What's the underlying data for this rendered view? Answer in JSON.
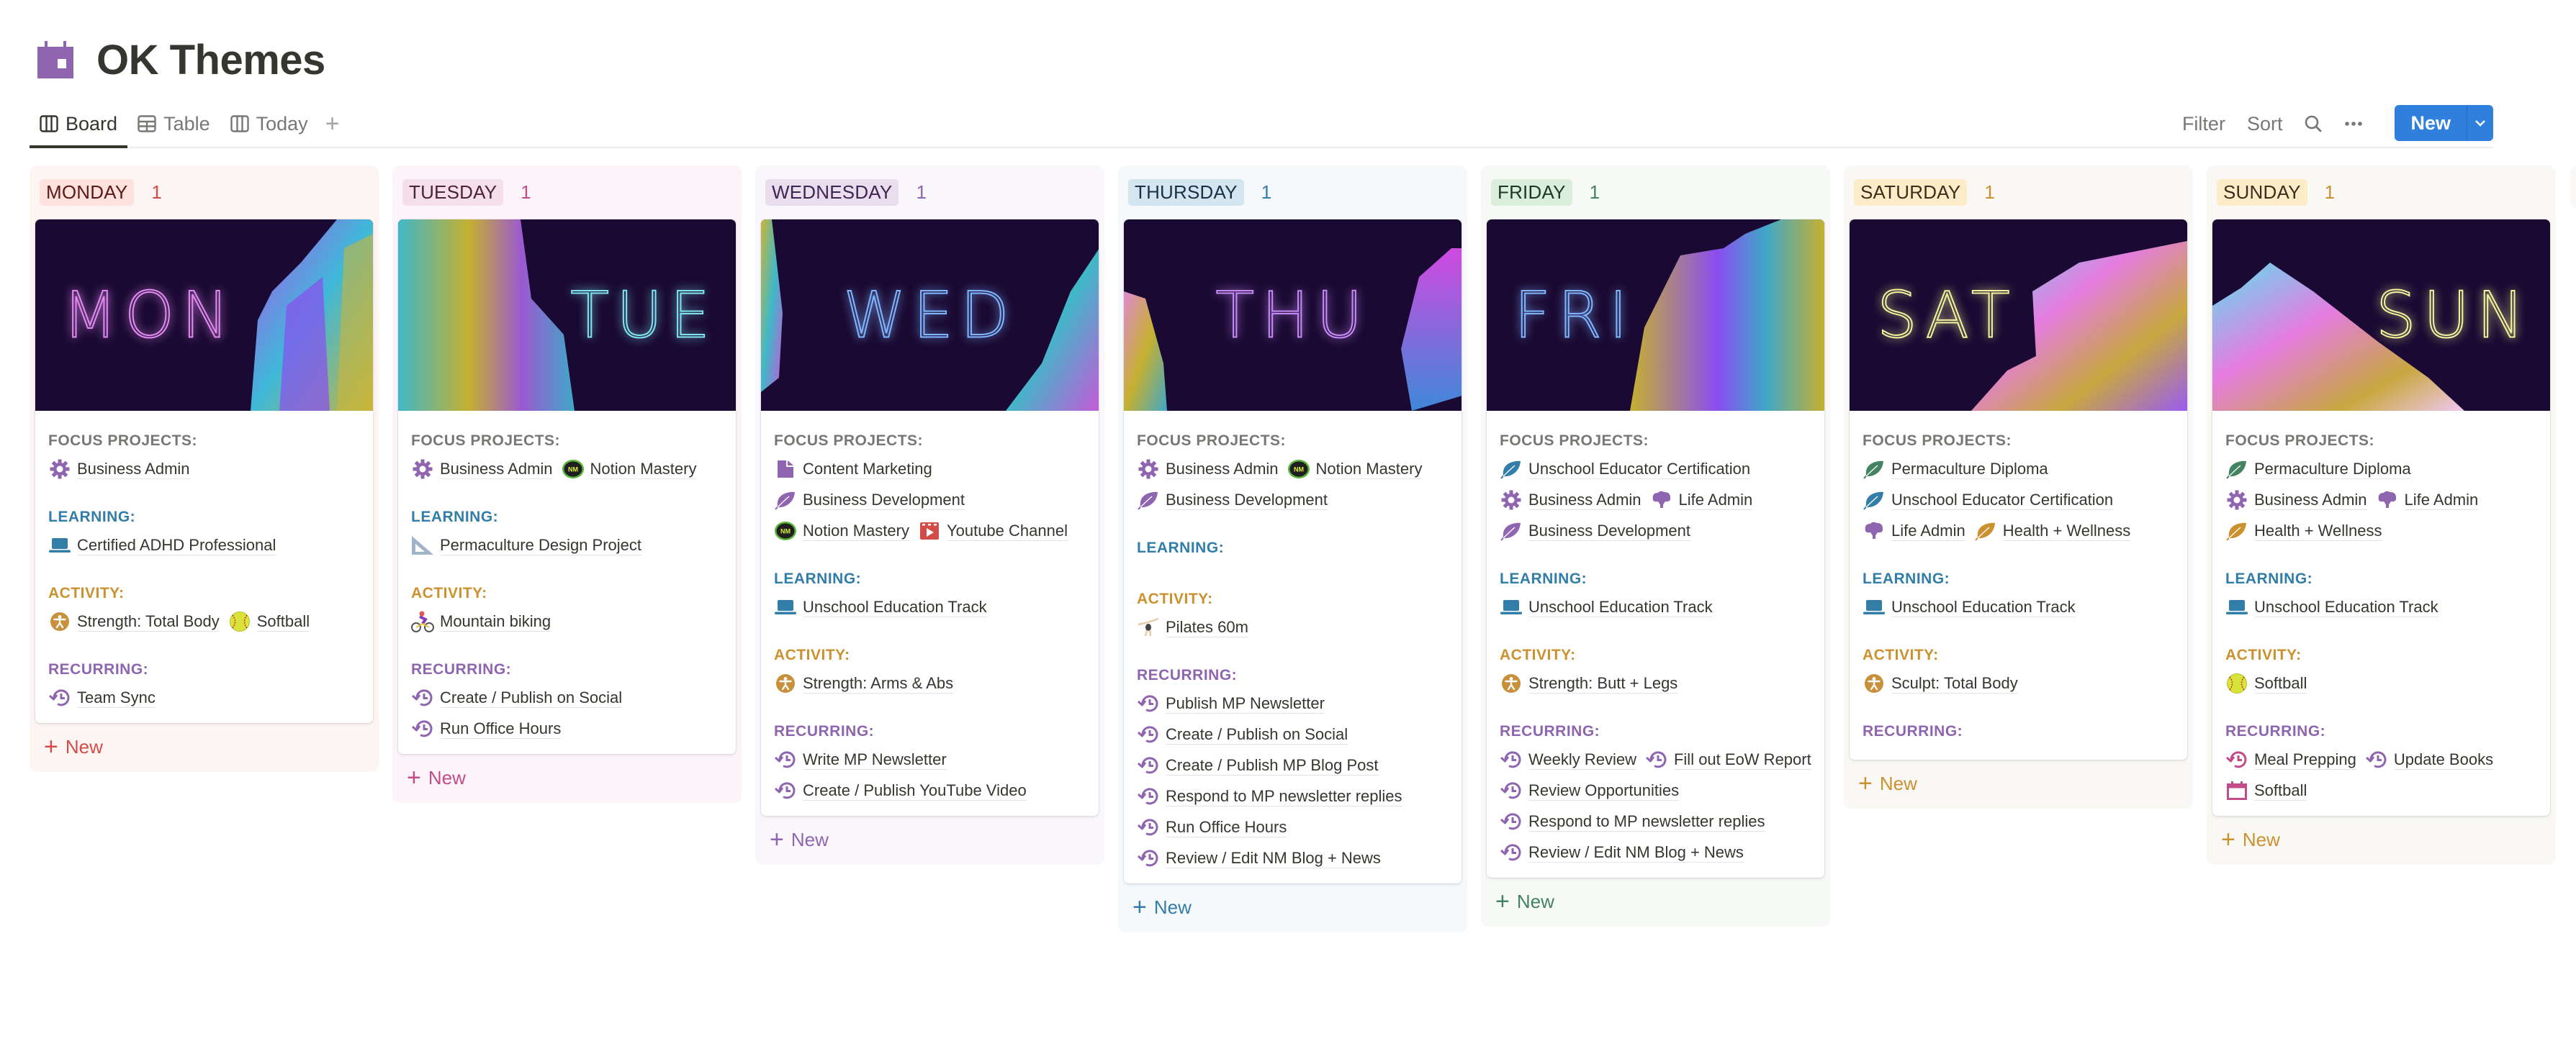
{
  "page": {
    "title": "OK Themes",
    "title_icon": "calendar-icon",
    "title_icon_color": "#9065b0"
  },
  "views": {
    "tabs": [
      {
        "label": "Board",
        "icon": "board-icon",
        "active": true
      },
      {
        "label": "Table",
        "icon": "table-icon",
        "active": false
      },
      {
        "label": "Today",
        "icon": "board-icon",
        "active": false
      }
    ],
    "add_view_icon": "plus-icon"
  },
  "toolbar": {
    "filter_label": "Filter",
    "sort_label": "Sort",
    "search_icon": "search-icon",
    "more_icon": "more-icon",
    "new_label": "New",
    "new_caret_icon": "chevron-down-icon",
    "new_color": "#2f80dd"
  },
  "section_labels": {
    "focus": "FOCUS PROJECTS:",
    "learning": "LEARNING:",
    "activity": "ACTIVITY:",
    "recurring": "RECURRING:"
  },
  "section_colors": {
    "focus": "#787774",
    "learning": "#337ea9",
    "activity": "#cb912f",
    "recurring": "#9065b0"
  },
  "add_new_label": "New",
  "columns": [
    {
      "day": "MONDAY",
      "count": "1",
      "cover_text": "MON",
      "colors": {
        "bg": "#fdf5f4",
        "pill": "#ffe2dd",
        "pill_text": "#5d1715",
        "count": "#d44c47",
        "neon": "#e38af0"
      },
      "focus": [
        {
          "icon": "gear-icon",
          "label": "Business Admin"
        }
      ],
      "learning": [
        {
          "icon": "laptop-icon",
          "label": "Certified ADHD Professional"
        }
      ],
      "activity": [
        {
          "icon": "accessibility-icon",
          "label": "Strength: Total Body"
        },
        {
          "icon": "softball-icon",
          "label": "Softball"
        }
      ],
      "recurring": [
        {
          "icon": "history-icon",
          "label": "Team Sync"
        }
      ]
    },
    {
      "day": "TUESDAY",
      "count": "1",
      "cover_text": "TUE",
      "colors": {
        "bg": "#fcf4f8",
        "pill": "#f5e0e9",
        "pill_text": "#4c2337",
        "count": "#c14c8a",
        "neon": "#7fe3ee"
      },
      "focus": [
        {
          "icon": "gear-icon",
          "label": "Business Admin"
        },
        {
          "icon": "notion-mastery-icon",
          "label": "Notion Mastery"
        }
      ],
      "learning": [
        {
          "icon": "triangle-ruler-icon",
          "label": "Permaculture Design Project"
        }
      ],
      "activity": [
        {
          "icon": "mountain-biking-icon",
          "label": "Mountain biking"
        }
      ],
      "recurring": [
        {
          "icon": "history-icon",
          "label": "Create / Publish on Social"
        },
        {
          "icon": "history-icon",
          "label": "Run Office Hours"
        }
      ]
    },
    {
      "day": "WEDNESDAY",
      "count": "1",
      "cover_text": "WED",
      "colors": {
        "bg": "#faf7fc",
        "pill": "#e8deee",
        "pill_text": "#412454",
        "count": "#9065b0",
        "neon": "#7fb6ff"
      },
      "focus": [
        {
          "icon": "document-icon",
          "label": "Content Marketing"
        },
        {
          "icon": "leaf-icon",
          "label": "Business Development"
        },
        {
          "icon": "notion-mastery-icon",
          "label": "Notion Mastery"
        },
        {
          "icon": "video-icon",
          "label": "Youtube Channel"
        }
      ],
      "learning": [
        {
          "icon": "laptop-icon",
          "label": "Unschool Education Track"
        }
      ],
      "activity": [
        {
          "icon": "accessibility-icon",
          "label": "Strength: Arms & Abs"
        }
      ],
      "recurring": [
        {
          "icon": "history-icon",
          "label": "Write MP Newsletter"
        },
        {
          "icon": "history-icon",
          "label": "Create / Publish YouTube Video"
        }
      ]
    },
    {
      "day": "THURSDAY",
      "count": "1",
      "cover_text": "THU",
      "colors": {
        "bg": "#f5f9fc",
        "pill": "#d3e5ef",
        "pill_text": "#183347",
        "count": "#337ea9",
        "neon": "#c58af5"
      },
      "focus": [
        {
          "icon": "gear-icon",
          "label": "Business Admin"
        },
        {
          "icon": "notion-mastery-icon",
          "label": "Notion Mastery"
        },
        {
          "icon": "leaf-icon",
          "label": "Business Development"
        }
      ],
      "learning": [],
      "activity": [
        {
          "icon": "pilates-icon",
          "label": "Pilates 60m"
        }
      ],
      "recurring": [
        {
          "icon": "history-icon",
          "label": "Publish MP Newsletter"
        },
        {
          "icon": "history-icon",
          "label": "Create / Publish on Social"
        },
        {
          "icon": "history-icon",
          "label": "Create / Publish MP Blog Post"
        },
        {
          "icon": "history-icon",
          "label": "Respond to MP newsletter replies"
        },
        {
          "icon": "history-icon",
          "label": "Run Office Hours"
        },
        {
          "icon": "history-icon",
          "label": "Review / Edit NM Blog + News"
        }
      ]
    },
    {
      "day": "FRIDAY",
      "count": "1",
      "cover_text": "FRI",
      "colors": {
        "bg": "#f6f9f6",
        "pill": "#dbeddb",
        "pill_text": "#1c3829",
        "count": "#448361",
        "neon": "#7fb6ff"
      },
      "focus": [
        {
          "icon": "leaf-icon-blue",
          "label": "Unschool Educator Certification"
        },
        {
          "icon": "gear-icon",
          "label": "Business Admin"
        },
        {
          "icon": "tree-icon",
          "label": "Life Admin"
        },
        {
          "icon": "leaf-icon",
          "label": "Business Development"
        }
      ],
      "learning": [
        {
          "icon": "laptop-icon",
          "label": "Unschool Education Track"
        }
      ],
      "activity": [
        {
          "icon": "accessibility-icon",
          "label": "Strength: Butt + Legs"
        }
      ],
      "recurring": [
        {
          "icon": "history-icon",
          "label": "Weekly Review"
        },
        {
          "icon": "history-icon",
          "label": "Fill out EoW Report"
        },
        {
          "icon": "history-icon",
          "label": "Review Opportunities"
        },
        {
          "icon": "history-icon",
          "label": "Respond to MP newsletter replies"
        },
        {
          "icon": "history-icon",
          "label": "Review / Edit NM Blog + News"
        }
      ]
    },
    {
      "day": "SATURDAY",
      "count": "1",
      "cover_text": "SAT",
      "colors": {
        "bg": "#f9f8f4",
        "pill": "#fdecc8",
        "pill_text": "#402c1b",
        "count": "#cb912f",
        "neon": "#f2f29a"
      },
      "focus": [
        {
          "icon": "leaf-icon-green",
          "label": "Permaculture Diploma"
        },
        {
          "icon": "leaf-icon-blue",
          "label": "Unschool Educator Certification"
        },
        {
          "icon": "tree-icon",
          "label": "Life Admin"
        },
        {
          "icon": "leaf-icon-orange",
          "label": "Health + Wellness"
        }
      ],
      "learning": [
        {
          "icon": "laptop-icon",
          "label": "Unschool Education Track"
        }
      ],
      "activity": [
        {
          "icon": "accessibility-icon",
          "label": "Sculpt: Total Body"
        }
      ],
      "recurring": []
    },
    {
      "day": "SUNDAY",
      "count": "1",
      "cover_text": "SUN",
      "colors": {
        "bg": "#f9f8f4",
        "pill": "#fdecc8",
        "pill_text": "#402c1b",
        "count": "#cb912f",
        "neon": "#f2f29a"
      },
      "focus": [
        {
          "icon": "leaf-icon-green",
          "label": "Permaculture Diploma"
        },
        {
          "icon": "gear-icon",
          "label": "Business Admin"
        },
        {
          "icon": "tree-icon",
          "label": "Life Admin"
        },
        {
          "icon": "leaf-icon-orange",
          "label": "Health + Wellness"
        }
      ],
      "learning": [
        {
          "icon": "laptop-icon",
          "label": "Unschool Education Track"
        }
      ],
      "activity": [
        {
          "icon": "softball-icon",
          "label": "Softball"
        }
      ],
      "recurring": [
        {
          "icon": "history-icon-pink",
          "label": "Meal Prepping"
        },
        {
          "icon": "history-icon",
          "label": "Update Books"
        },
        {
          "icon": "calendar-icon-pink",
          "label": "Softball"
        }
      ]
    }
  ]
}
